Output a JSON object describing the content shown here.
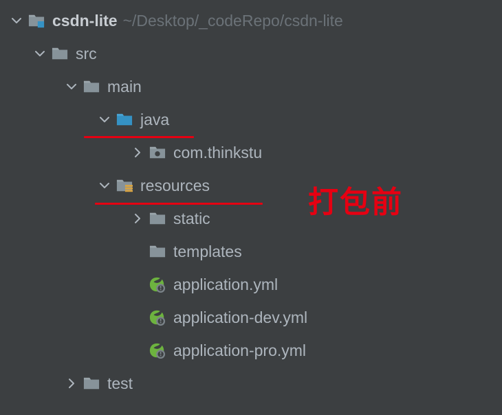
{
  "project": {
    "name": "csdn-lite",
    "path": "~/Desktop/_codeRepo/csdn-lite"
  },
  "tree": {
    "src": "src",
    "main": "main",
    "java": "java",
    "pkg": "com.thinkstu",
    "resources": "resources",
    "static": "static",
    "templates": "templates",
    "app_yml": "application.yml",
    "app_dev": "application-dev.yml",
    "app_pro": "application-pro.yml",
    "test": "test"
  },
  "annotation": "打包前"
}
